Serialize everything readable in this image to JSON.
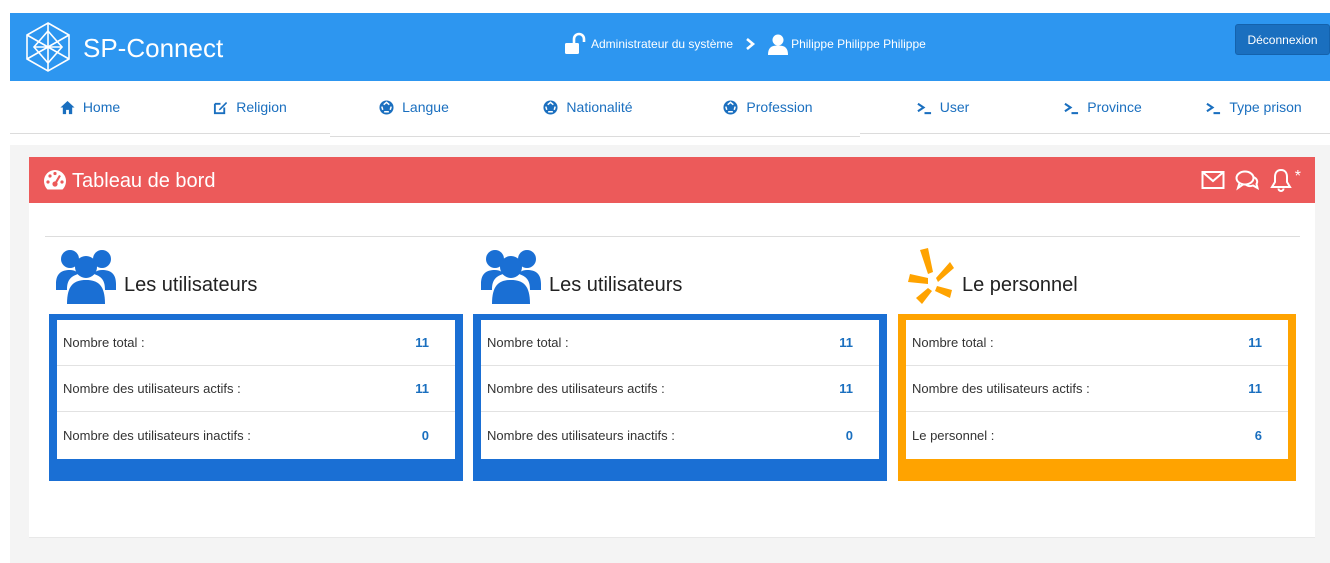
{
  "header": {
    "app_title": "SP-Connect",
    "role": "Administrateur du système",
    "user_name": "Philippe Philippe Philippe",
    "logout_label": "Déconnexion",
    "colors": {
      "bar": "#2d96f0",
      "button": "#1a6fbf"
    }
  },
  "nav": {
    "items": [
      {
        "label": "Home",
        "icon": "home-icon"
      },
      {
        "label": "Religion",
        "icon": "edit-icon"
      },
      {
        "label": "Langue",
        "icon": "recycle-icon"
      },
      {
        "label": "Nationalité",
        "icon": "recycle-icon"
      },
      {
        "label": "Profession",
        "icon": "recycle-icon"
      },
      {
        "label": "User",
        "icon": "terminal-icon"
      },
      {
        "label": "Province",
        "icon": "terminal-icon"
      },
      {
        "label": "Type prison",
        "icon": "terminal-icon"
      }
    ]
  },
  "panel": {
    "title": "Tableau de bord",
    "star": "*",
    "header_color": "#ec5a5a"
  },
  "cards": [
    {
      "title": "Les utilisateurs",
      "icon": "users-icon",
      "color": "#1a6fd4",
      "rows": [
        {
          "label": "Nombre total :",
          "value": "11"
        },
        {
          "label": "Nombre des utilisateurs actifs :",
          "value": "11"
        },
        {
          "label": "Nombre des utilisateurs inactifs :",
          "value": "0"
        }
      ]
    },
    {
      "title": "Les utilisateurs",
      "icon": "users-icon",
      "color": "#1a6fd4",
      "rows": [
        {
          "label": "Nombre total :",
          "value": "11"
        },
        {
          "label": "Nombre des utilisateurs actifs :",
          "value": "11"
        },
        {
          "label": "Nombre des utilisateurs inactifs :",
          "value": "0"
        }
      ]
    },
    {
      "title": "Le personnel",
      "icon": "yelp-icon",
      "color": "#ffa300",
      "rows": [
        {
          "label": "Nombre total :",
          "value": "11"
        },
        {
          "label": "Nombre des utilisateurs actifs :",
          "value": "11"
        },
        {
          "label": "Le personnel :",
          "value": "6"
        }
      ]
    }
  ]
}
